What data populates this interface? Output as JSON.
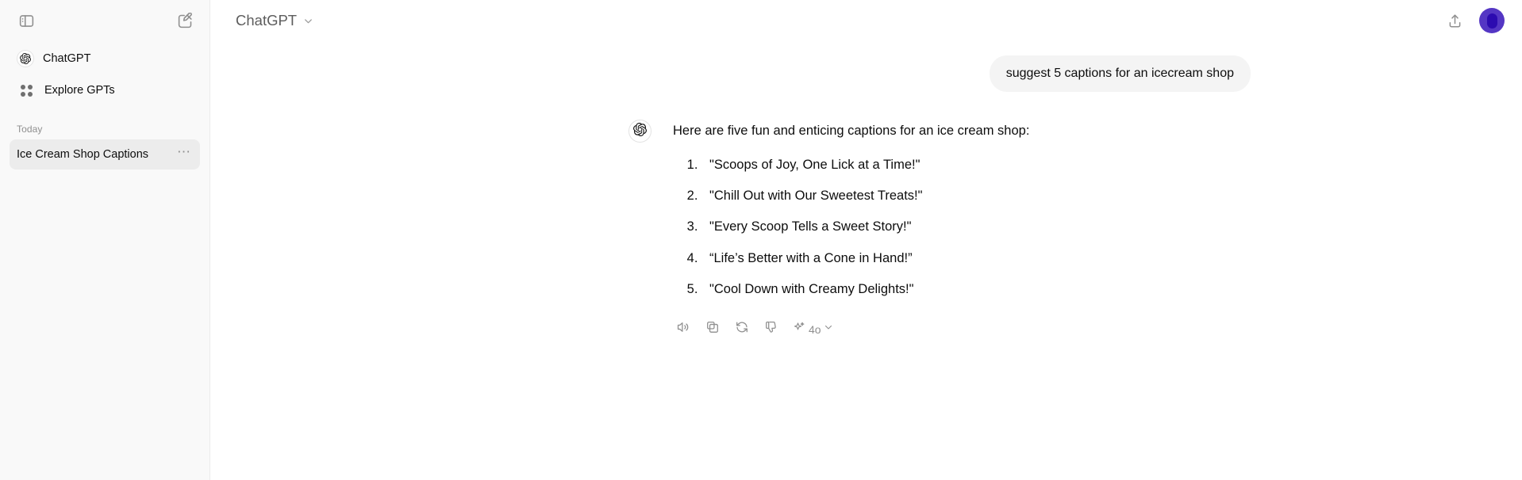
{
  "sidebar": {
    "toggle_icon": "sidebar-panel-icon",
    "new_chat_icon": "new-chat-pencil-icon",
    "nav": [
      {
        "label": "ChatGPT",
        "icon": "openai-logo-icon"
      },
      {
        "label": "Explore GPTs",
        "icon": "grid-apps-icon"
      }
    ],
    "section_label": "Today",
    "conversations": [
      {
        "title": "Ice Cream Shop Captions",
        "menu_icon": "ellipsis-icon",
        "active": true
      }
    ],
    "background": "#f9f9f9",
    "active_background": "#ececec"
  },
  "topbar": {
    "model_name": "ChatGPT",
    "model_chevron_icon": "chevron-down-icon",
    "share_icon": "share-upload-icon",
    "avatar_icon": "user-avatar",
    "avatar_color": "#5436c4"
  },
  "conversation": {
    "user_message": "suggest 5 captions for an icecream shop",
    "assistant_avatar_icon": "openai-logo-icon",
    "assistant_intro": "Here are five fun and enticing captions for an ice cream shop:",
    "captions": [
      "\"Scoops of Joy, One Lick at a Time!\"",
      "\"Chill Out with Our Sweetest Treats!\"",
      "\"Every Scoop Tells a Sweet Story!\"",
      "“Life’s Better with a Cone in Hand!”",
      "\"Cool Down with Creamy Delights!\""
    ],
    "actions": [
      {
        "name": "read-aloud",
        "icon": "speaker-icon"
      },
      {
        "name": "copy",
        "icon": "copy-icon"
      },
      {
        "name": "regenerate",
        "icon": "refresh-icon"
      },
      {
        "name": "bad-response",
        "icon": "thumbs-down-icon"
      }
    ],
    "model_tag": {
      "label": "4o",
      "icon": "sparkle-icon",
      "chevron": "chevron-down-icon"
    }
  }
}
